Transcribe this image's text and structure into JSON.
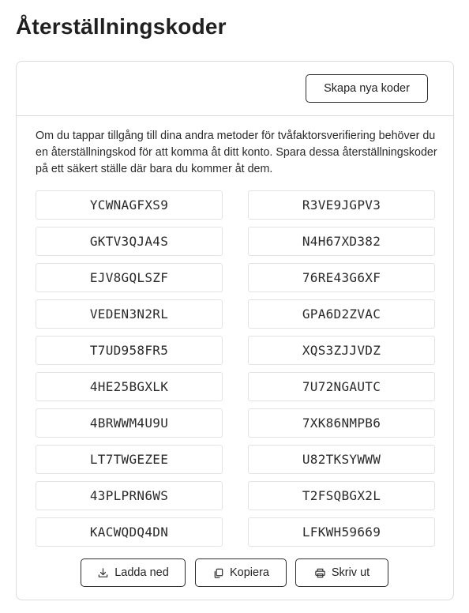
{
  "page": {
    "title": "Återställningskoder"
  },
  "header": {
    "new_codes_label": "Skapa nya koder"
  },
  "description": "Om du tappar tillgång till dina andra metoder för tvåfaktorsverifiering behöver du en återställningskod för att komma åt ditt konto. Spara dessa återställningskoder på ett säkert ställe där bara du kommer åt dem.",
  "codes": [
    "YCWNAGFXS9",
    "R3VE9JGPV3",
    "GKTV3QJA4S",
    "N4H67XD382",
    "EJV8GQLSZF",
    "76RE43G6XF",
    "VEDEN3N2RL",
    "GPA6D2ZVAC",
    "T7UD958FR5",
    "XQS3ZJJVDZ",
    "4HE25BGXLK",
    "7U72NGAUTC",
    "4BRWWM4U9U",
    "7XK86NMPB6",
    "LT7TWGEZEE",
    "U82TKSYWWW",
    "43PLPRN6WS",
    "T2FSQBGX2L",
    "KACWQDQ4DN",
    "LFKWH59669"
  ],
  "actions": {
    "download_label": "Ladda ned",
    "download_icon": "download-icon",
    "copy_label": "Kopiera",
    "copy_icon": "copy-icon",
    "print_label": "Skriv ut",
    "print_icon": "printer-icon"
  }
}
